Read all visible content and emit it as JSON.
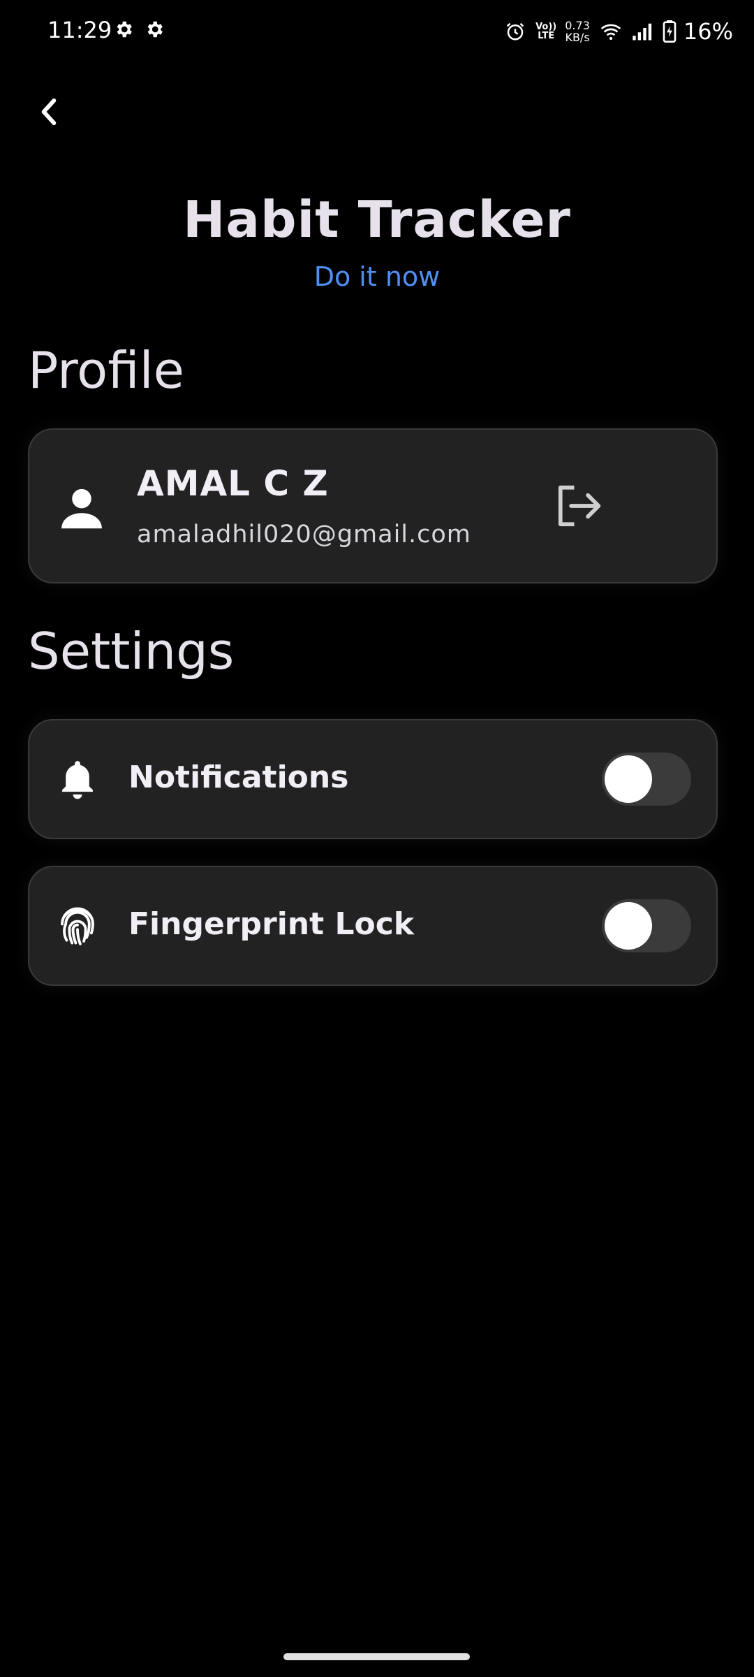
{
  "status_bar": {
    "time": "11:29",
    "left_icons": [
      "gear-icon",
      "gear-icon"
    ],
    "right_icons": [
      "alarm-icon",
      "volte-icon",
      "net-speed",
      "wifi-icon",
      "signal-icon",
      "battery-charging-icon"
    ],
    "volte_line1": "Vo))",
    "volte_line2": "LTE",
    "net_speed_value": "0.73",
    "net_speed_unit": "KB/s",
    "battery_percent": "16%"
  },
  "header": {
    "back_icon": "chevron-left-icon",
    "title": "Habit Tracker",
    "subtitle": "Do it now"
  },
  "profile": {
    "section_title": "Profile",
    "icon": "person-icon",
    "name": "AMAL C Z",
    "email": "amaladhil020@gmail.com",
    "logout_icon": "logout-icon"
  },
  "settings": {
    "section_title": "Settings",
    "items": [
      {
        "label": "Notifications",
        "icon": "bell-icon",
        "enabled": false
      },
      {
        "label": "Fingerprint Lock",
        "icon": "fingerprint-icon",
        "enabled": false
      }
    ]
  },
  "colors": {
    "background": "#000000",
    "card": "#222222",
    "accent": "#4f8ff3",
    "title_text": "#e6e1ea",
    "toggle_track_off": "#3b3b3b"
  }
}
